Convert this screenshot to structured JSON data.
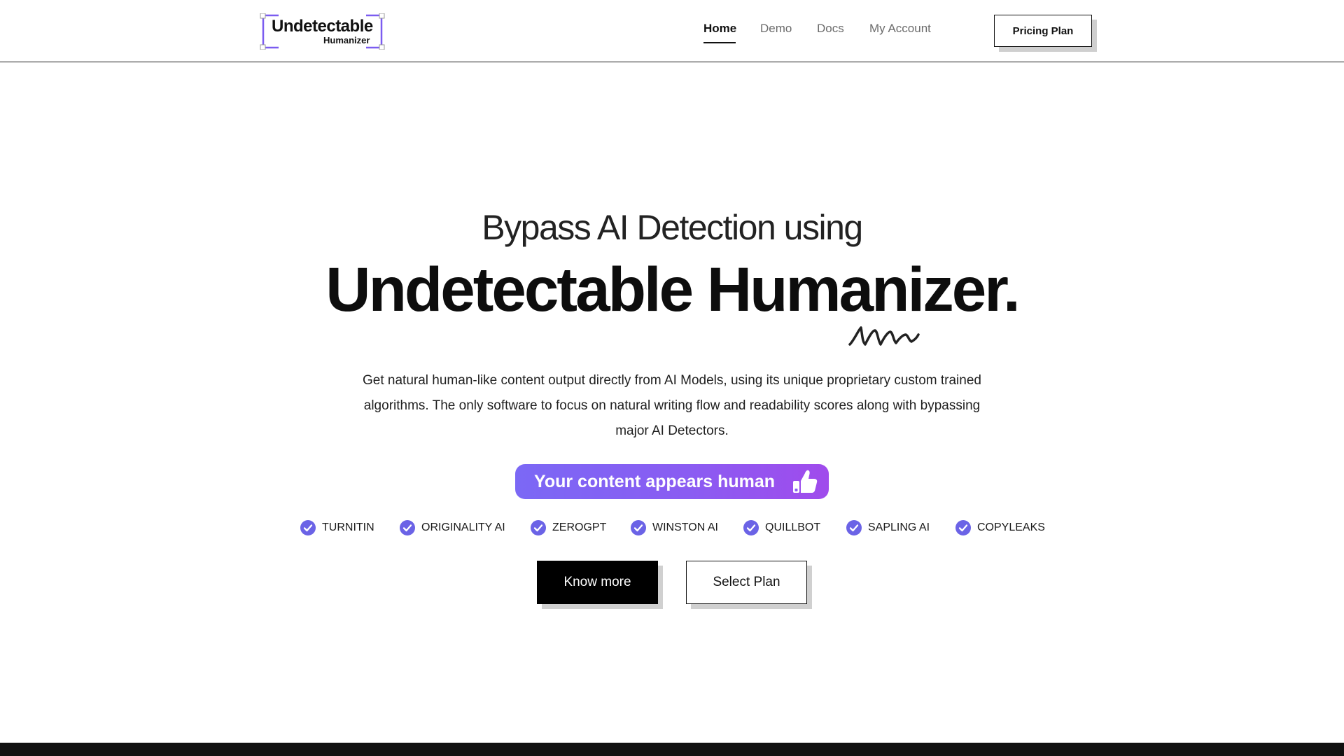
{
  "header": {
    "logo": {
      "title": "Undetectable",
      "subtitle": "Humanizer",
      "accent_color": "#7b5cf0"
    },
    "nav": [
      {
        "label": "Home",
        "active": true
      },
      {
        "label": "Demo",
        "active": false
      },
      {
        "label": "Docs",
        "active": false
      },
      {
        "label": "My Account",
        "active": false
      }
    ],
    "pricing_button": "Pricing Plan"
  },
  "hero": {
    "subheading": "Bypass AI Detection using",
    "heading": "Undetectable Humanizer.",
    "description": "Get natural human-like content output directly from AI Models, using its unique proprietary custom trained algorithms. The only software to focus on natural writing flow and readability scores along with bypassing major AI Detectors.",
    "badge": {
      "text": "Your content appears human",
      "icon": "thumbs-up-icon",
      "gradient": [
        "#7b68f5",
        "#a04bec"
      ]
    },
    "detectors": [
      "TURNITIN",
      "ORIGINALITY AI",
      "ZEROGPT",
      "WINSTON AI",
      "QUILLBOT",
      "SAPLING AI",
      "COPYLEAKS"
    ],
    "check_color": "#6b63e6",
    "know_more_button": "Know more",
    "select_plan_button": "Select Plan"
  }
}
